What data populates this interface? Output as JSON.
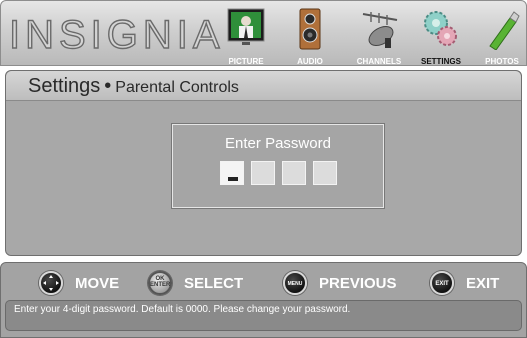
{
  "brand": {
    "logo_text": "INSIGNIA"
  },
  "menu": {
    "items": [
      {
        "label": "PICTURE",
        "icon": "picture-icon"
      },
      {
        "label": "AUDIO",
        "icon": "speaker-icon"
      },
      {
        "label": "CHANNELS",
        "icon": "satellite-dish-icon"
      },
      {
        "label": "SETTINGS",
        "icon": "gears-icon",
        "active": true
      },
      {
        "label": "PHOTOS",
        "icon": "usb-stick-icon"
      }
    ]
  },
  "breadcrumb": {
    "section": "Settings",
    "separator": "•",
    "page": "Parental Controls"
  },
  "password_dialog": {
    "title": "Enter Password",
    "digit_count": 4,
    "cursor_position": 1
  },
  "controls": [
    {
      "label": "MOVE",
      "button": ""
    },
    {
      "label": "SELECT",
      "button": "OK\nENTER"
    },
    {
      "label": "PREVIOUS",
      "button": "MENU"
    },
    {
      "label": "EXIT",
      "button": "EXIT"
    }
  ],
  "help_text": "Enter your 4-digit password. Default is 0000. Please change your password.",
  "colors": {
    "panel": "#a8a8a8",
    "bar": "#a3a3a3",
    "label_active": "#111111",
    "label": "#ffffff"
  }
}
